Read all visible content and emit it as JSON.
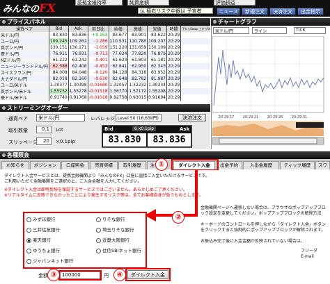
{
  "app": {
    "logo_prefix": "みんなの",
    "logo_brand": "FX"
  },
  "top": {
    "cell1": "証拠金維持率",
    "cell2": "純資産額",
    "ticker": "仏 極右リスク中銀は 予言者",
    "buttons": [
      "ニュース",
      "新規注文",
      "決済注文",
      "出金指示"
    ],
    "right_cells": [
      "評価損益",
      ""
    ]
  },
  "price_panel": {
    "title": "プライスパネル",
    "headers": [
      "通貨ペア",
      "Bid",
      "Ask",
      "前日比",
      "始値",
      "高値",
      "安値",
      "時間"
    ],
    "toggle": "下からSwap 上からSwap",
    "rows": [
      {
        "pair": "米ドル/円",
        "bid": "83.830",
        "ask": "83.836",
        "chg": "+0.153",
        "open": "83.677",
        "high": "83.901",
        "low": "83.622",
        "time": "20:29"
      },
      {
        "pair": "ユーロ/円",
        "bid": "109.245",
        "ask": "109.262",
        "chg": "-1.286",
        "open": "110.531",
        "high": "110.780",
        "low": "109.207",
        "time": "20:29"
      },
      {
        "pair": "英ポンド/円",
        "bid": "130.151",
        "ask": "130.171",
        "chg": "-1.059",
        "open": "131.220",
        "high": "131.659",
        "low": "130.109",
        "time": "20:29"
      },
      {
        "pair": "豪ドル/円",
        "bid": "76.911",
        "ask": "76.931",
        "chg": "-0.713",
        "open": "77.624",
        "high": "77.820",
        "low": "76.879",
        "time": "20:29"
      },
      {
        "pair": "NZドル/円",
        "bid": "61.222",
        "ask": "61.242",
        "chg": "-0.401",
        "open": "61.623",
        "high": "61.803",
        "low": "61.181",
        "time": "20:29"
      },
      {
        "pair": "ニュージーランドドル/円",
        "bid": "62.388",
        "ask": "62.408",
        "chg": "-0.453",
        "open": "62.841",
        "high": "62.950",
        "low": "62.343",
        "time": "20:29"
      },
      {
        "pair": "スイスフラン/円",
        "bid": "84.008",
        "ask": "84.048",
        "chg": "-0.120",
        "open": "84.128",
        "high": "84.318",
        "low": "83.952",
        "time": "20:29"
      },
      {
        "pair": "カナダドル/円",
        "bid": "82.018",
        "ask": "82.160",
        "chg": "-0.630",
        "open": "82.648",
        "high": "82.782",
        "low": "81.987",
        "time": "20:29"
      },
      {
        "pair": "ユーロ/米ドル",
        "bid": "1.30377",
        "ask": "1.30398",
        "chg": "-0.01680",
        "open": "1.32057",
        "high": "1.32232",
        "low": "1.30334",
        "time": "20:29"
      },
      {
        "pair": "英ポンド/米ドル",
        "bid": "1.55252",
        "ask": "1.55278",
        "chg": "-0.01518",
        "open": "1.56770",
        "high": "1.57172",
        "low": "1.55208",
        "time": "20:29"
      },
      {
        "pair": "豪ドル/米ドル",
        "bid": "0.91740",
        "ask": "0.91768",
        "chg": "-0.01018",
        "open": "0.92758",
        "high": "0.93015",
        "low": "0.91694",
        "time": "20:29"
      }
    ]
  },
  "streaming": {
    "title": "ストリーミングオーダー",
    "pair_label": "通貨ペア",
    "pair_value": "米ドル/円",
    "leverage_label": "レバレッジ",
    "leverage_value": "Level 50 (16,658円)",
    "settle_btn": "決済注文",
    "qty_label": "取引数量",
    "qty_value": "0.1",
    "qty_unit": "Lot",
    "slip_label": "スリッページ",
    "slip_value": "20",
    "slip_unit": "×0.1pip",
    "bid_label": "Bid",
    "spread": "6 x0.1pip",
    "ask_label": "Ask",
    "bid": "83.830",
    "ask": "83.836"
  },
  "chart": {
    "title": "チャートグラフ",
    "pair": "米ドル/円",
    "type": "ライン",
    "interval": "TICK",
    "x_labels": [
      "20:29:17",
      "20:29:21",
      "20:29:26",
      "20:29:31"
    ],
    "y_labels": [
      "83.90",
      "83.85",
      "83.80",
      "83.75"
    ]
  },
  "tabs_panel": {
    "title": "各種照会",
    "tabs": [
      "お知らせ",
      "ポジション",
      "口座照会",
      "売買実績",
      "取引履歴",
      "注文",
      "ダイレクト入金",
      "出金予約",
      "入出金履歴",
      "ティック履歴",
      "スワ"
    ],
    "active_index": 6
  },
  "deposit": {
    "desc1": "ダイレクト入金サービスとは、提携金融機関より「みんなのFX」口座に直接ご入金いただけるサービスです。",
    "desc2": "ご利用いただく金融機関をご選択の上、ご入金金額を入力してください。",
    "note1": "※ダイレクト入金は即時反映を保証するサービスではございません。あらかじめご了承ください。",
    "note2": "※リアルタイムに反映できなかったことにより発生するリスク等は、全てお客様自身が負うものとします。",
    "banks": [
      {
        "name": "みずほ銀行",
        "selected": false
      },
      {
        "name": "りそな銀行",
        "selected": false
      },
      {
        "name": "三井住友銀行",
        "selected": false
      },
      {
        "name": "埼玉りそな銀行",
        "selected": false
      },
      {
        "name": "楽天銀行",
        "selected": true
      },
      {
        "name": "近畿大阪銀行",
        "selected": false
      },
      {
        "name": "ゆうちょ銀行",
        "selected": false
      },
      {
        "name": "住信SBIネット銀行",
        "selected": false
      },
      {
        "name": "ジャパンネット銀行",
        "selected": false
      }
    ],
    "amount_label": "金額",
    "amount_value": "100000",
    "amount_unit": "円",
    "submit": "ダイレクト入金",
    "side_text1": "金融機関ページへ遷移しない場合は、ブラウザのポップアップブロック設定を変更してください。ポップアップブロックの解除方法",
    "side_text2": "キーボードのコントロールを押しながら「ダイレクト入金」ボタンをクリックすると強制的にポップアップブロックが解除されます。",
    "side_text3": "お振込み完了後に入金金額が反映されていない場合は、",
    "side_text4": "フリーダ",
    "side_text5": "E-mail"
  },
  "markers": [
    "①",
    "②",
    "③",
    "④"
  ]
}
